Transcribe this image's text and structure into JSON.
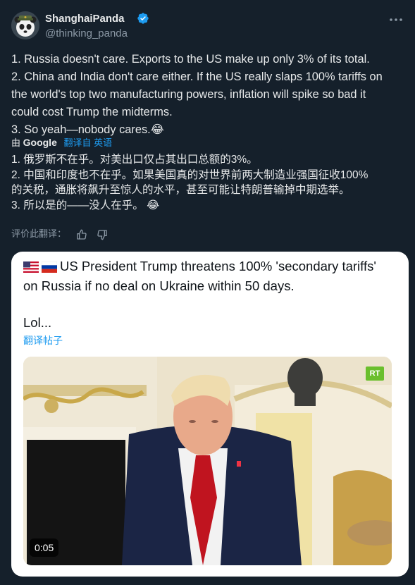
{
  "author": {
    "display_name": "ShanghaiPanda",
    "handle": "@thinking_panda"
  },
  "tweet": {
    "lines": [
      "1. Russia doesn't care. Exports to the US make up only 3% of its total.",
      "2. China and India don't care either. If the US really slaps 100% tariffs on",
      "the world's top two manufacturing powers, inflation will spike so bad it",
      "could cost Trump the midterms.",
      "3. So yeah—nobody cares.😂"
    ]
  },
  "translation_bar": {
    "prefix": "由",
    "provider": "Google",
    "source": "翻译自 英语"
  },
  "translation": {
    "lines": [
      "1. 俄罗斯不在乎。对美出口仅占其出口总额的3%。",
      "2. 中国和印度也不在乎。如果美国真的对世界前两大制造业强国征收100%",
      "的关税，通胀将飙升至惊人的水平，甚至可能让特朗普输掉中期选举。",
      "3. 所以是的——没人在乎。 😂"
    ]
  },
  "rate": {
    "label": "评价此翻译："
  },
  "quote": {
    "line1": "US President Trump threatens 100% 'secondary tariffs'",
    "line2": "on Russia if no deal on Ukraine within 50 days.",
    "lol": "Lol...",
    "translate_link": "翻译帖子",
    "video_duration": "0:05",
    "rt_logo": "RT"
  },
  "colors": {
    "background": "#15202b",
    "accent": "#1d9bf0",
    "card": "#ffffff"
  }
}
